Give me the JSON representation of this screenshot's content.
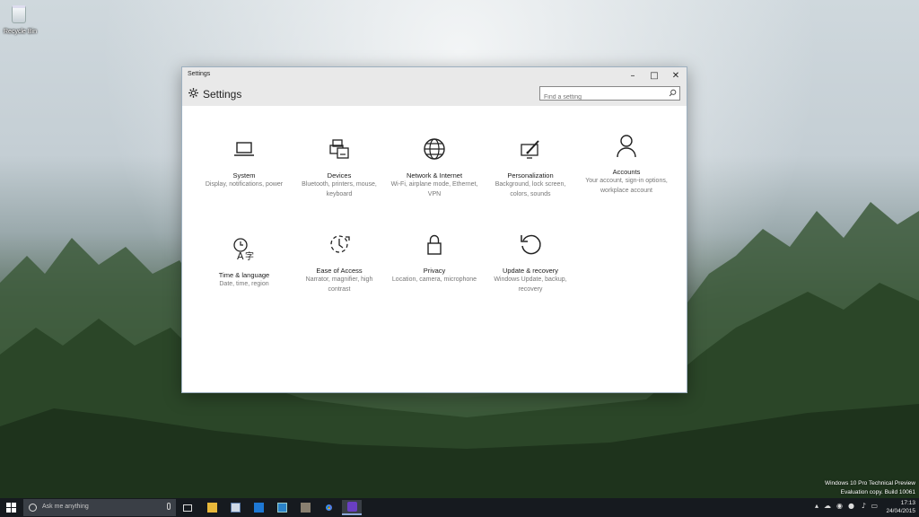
{
  "desktop": {
    "recycle_bin_label": "Recycle Bin",
    "watermark_line1": "Windows 10 Pro Technical Preview",
    "watermark_line2": "Evaluation copy. Build 10061"
  },
  "window": {
    "title": "Settings",
    "controls": {
      "minimize": "–",
      "maximize": "□",
      "close": "✕"
    },
    "header_title": "Settings",
    "search_placeholder": "Find a setting"
  },
  "categories": [
    {
      "name": "System",
      "desc": "Display, notifications, power",
      "icon": "laptop-icon"
    },
    {
      "name": "Devices",
      "desc": "Bluetooth, printers, mouse, keyboard",
      "icon": "devices-icon"
    },
    {
      "name": "Network & Internet",
      "desc": "Wi-Fi, airplane mode, Ethernet, VPN",
      "icon": "globe-icon"
    },
    {
      "name": "Personalization",
      "desc": "Background, lock screen, colors, sounds",
      "icon": "paintbrush-icon"
    },
    {
      "name": "Accounts",
      "desc": "Your account, sign-in options, workplace account",
      "icon": "person-icon"
    },
    {
      "name": "Time & language",
      "desc": "Date, time, region",
      "icon": "time-language-icon"
    },
    {
      "name": "Ease of Access",
      "desc": "Narrator, magnifier, high contrast",
      "icon": "ease-of-access-icon"
    },
    {
      "name": "Privacy",
      "desc": "Location, camera, microphone",
      "icon": "lock-icon"
    },
    {
      "name": "Update & recovery",
      "desc": "Windows Update, backup, recovery",
      "icon": "refresh-icon"
    }
  ],
  "taskbar": {
    "search_placeholder": "Ask me anything",
    "apps": [
      "task-view-icon",
      "file-explorer-icon",
      "store-icon",
      "outlook-icon",
      "app-icon",
      "media-icon",
      "chrome-icon",
      "settings-icon"
    ],
    "time": "17:13",
    "date": "24/04/2015"
  },
  "colors": {
    "accent": "#8da9d8",
    "taskbar": "#161a1f"
  }
}
